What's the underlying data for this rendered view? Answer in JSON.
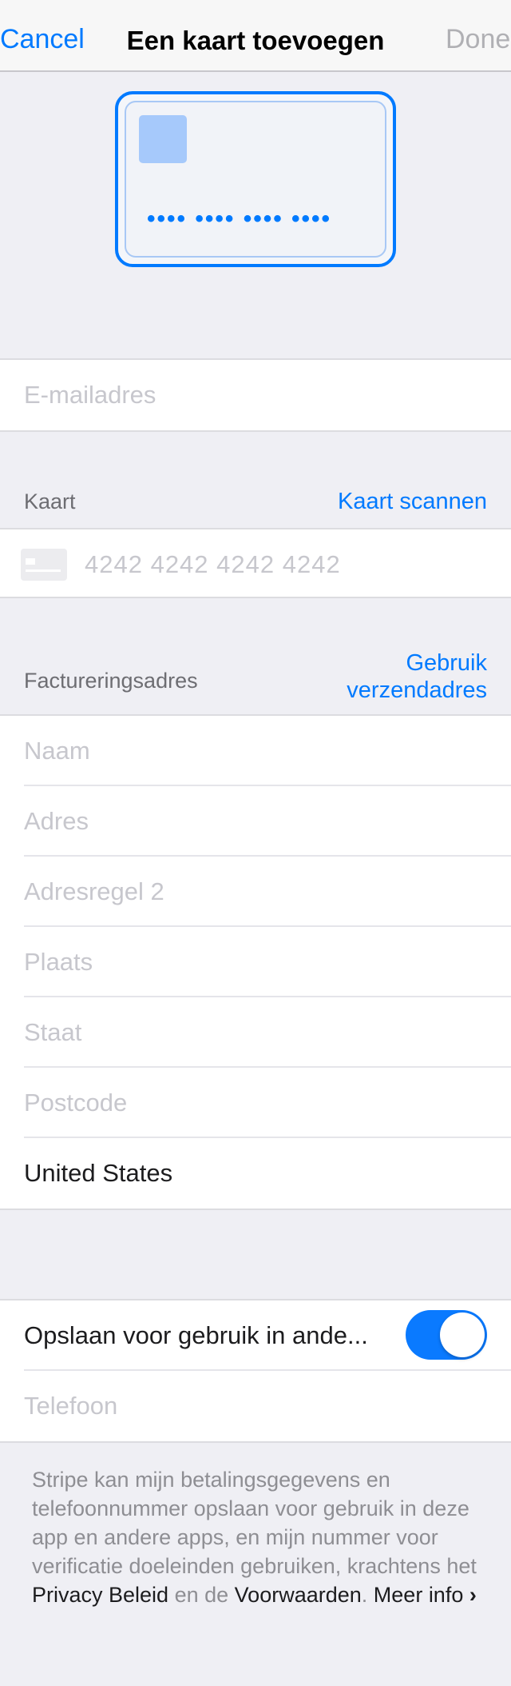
{
  "nav": {
    "cancel": "Cancel",
    "title": "Een kaart toevoegen",
    "done": "Done"
  },
  "card_preview": {
    "dots": "•••• •••• •••• ••••"
  },
  "email": {
    "placeholder": "E-mailadres"
  },
  "card_section": {
    "label": "Kaart",
    "scan_action": "Kaart scannen",
    "number_placeholder": "4242 4242 4242 4242"
  },
  "billing": {
    "label": "Factureringsadres",
    "action_line1": "Gebruik",
    "action_line2": "verzendadres",
    "fields": {
      "name": "Naam",
      "address": "Adres",
      "address2": "Adresregel 2",
      "city": "Plaats",
      "state": "Staat",
      "zip": "Postcode",
      "country": "United States"
    }
  },
  "save": {
    "label": "Opslaan voor gebruik in ande...",
    "toggle_on": true,
    "phone_placeholder": "Telefoon"
  },
  "footer": {
    "text1": "Stripe kan mijn betalingsgegevens en telefoonnummer opslaan voor gebruik in deze app en andere apps, en mijn nummer voor verificatie doeleinden gebruiken, krachtens het ",
    "privacy_link": "Privacy Beleid",
    "text2": " en de ",
    "terms_link": "Voorwaarden",
    "text3": ". ",
    "more_link": "Meer info",
    "chevron": "›"
  },
  "colors": {
    "accent": "#007aff",
    "background": "#efeff4",
    "placeholder": "#c7c7cd"
  }
}
